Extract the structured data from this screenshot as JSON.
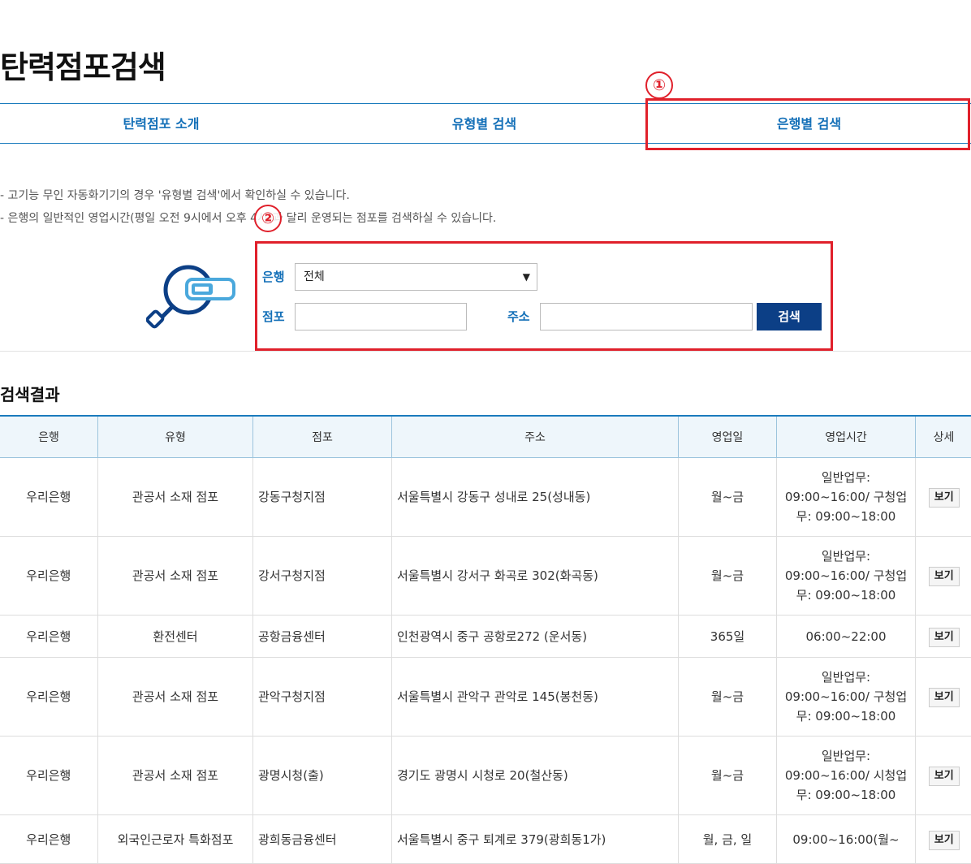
{
  "page": {
    "title": "탄력점포검색"
  },
  "tabs": [
    {
      "label": "탄력점포 소개"
    },
    {
      "label": "유형별 검색"
    },
    {
      "label": "은행별 검색"
    }
  ],
  "markers": {
    "m1": "①",
    "m2": "②"
  },
  "notices": [
    "- 고기능 무인 자동화기기의 경우 '유형별 검색'에서 확인하실 수 있습니다.",
    "- 은행의 일반적인 영업시간(평일 오전 9시에서 오후 4시)과 달리 운영되는 점포를 검색하실 수 있습니다."
  ],
  "search": {
    "bank_label": "은행",
    "bank_selected": "전체",
    "branch_label": "점포",
    "branch_value": "",
    "address_label": "주소",
    "address_value": "",
    "button_label": "검색"
  },
  "results": {
    "title": "검색결과",
    "columns": [
      "은행",
      "유형",
      "점포",
      "주소",
      "영업일",
      "영업시간",
      "상세"
    ],
    "rows": [
      {
        "bank": "우리은행",
        "type": "관공서 소재 점포",
        "branch": "강동구청지점",
        "address": "서울특별시 강동구 성내로 25(성내동)",
        "days": "월~금",
        "hours": "일반업무: 09:00~16:00/ 구청업무: 09:00~18:00",
        "detail": "보기"
      },
      {
        "bank": "우리은행",
        "type": "관공서 소재 점포",
        "branch": "강서구청지점",
        "address": "서울특별시 강서구 화곡로 302(화곡동)",
        "days": "월~금",
        "hours": "일반업무: 09:00~16:00/ 구청업무: 09:00~18:00",
        "detail": "보기"
      },
      {
        "bank": "우리은행",
        "type": "환전센터",
        "branch": "공항금융센터",
        "address": "인천광역시 중구 공항로272 (운서동)",
        "days": "365일",
        "hours": "06:00~22:00",
        "detail": "보기"
      },
      {
        "bank": "우리은행",
        "type": "관공서 소재 점포",
        "branch": "관악구청지점",
        "address": "서울특별시 관악구 관악로 145(봉천동)",
        "days": "월~금",
        "hours": "일반업무: 09:00~16:00/ 구청업무: 09:00~18:00",
        "detail": "보기"
      },
      {
        "bank": "우리은행",
        "type": "관공서 소재 점포",
        "branch": "광명시청(출)",
        "address": "경기도 광명시 시청로 20(철산동)",
        "days": "월~금",
        "hours": "일반업무: 09:00~16:00/ 시청업무: 09:00~18:00",
        "detail": "보기"
      },
      {
        "bank": "우리은행",
        "type": "외국인근로자 특화점포",
        "branch": "광희동금융센터",
        "address": "서울특별시 중구 퇴계로 379(광희동1가)",
        "days": "월, 금, 일",
        "hours": "09:00~16:00(월~",
        "detail": "보기"
      }
    ]
  },
  "icons": {
    "search_graphic": "magnifier-card-icon",
    "chevron": "chevron-down-icon"
  },
  "colors": {
    "accent": "#1470b8",
    "button": "#0c3f86",
    "highlight": "#e0202b"
  }
}
